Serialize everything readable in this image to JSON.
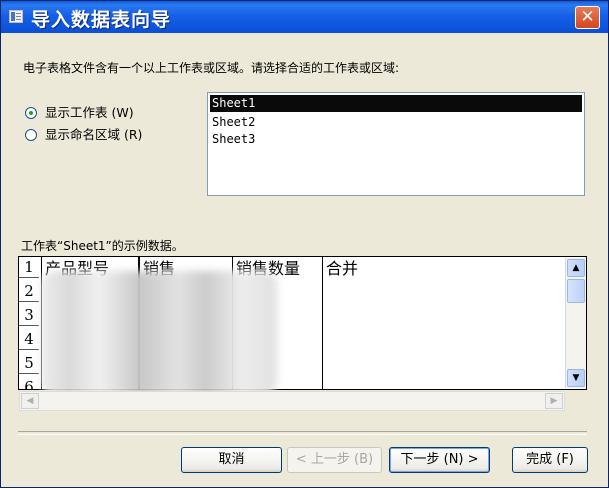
{
  "window": {
    "title": "导入数据表向导",
    "close_label": "✕"
  },
  "instructions": "电子表格文件含有一个以上工作表或区域。请选择合适的工作表或区域:",
  "options": [
    {
      "label": "显示工作表 (W)",
      "checked": true
    },
    {
      "label": "显示命名区域 (R)",
      "checked": false
    }
  ],
  "sheets": [
    {
      "name": "Sheet1",
      "selected": true
    },
    {
      "name": "Sheet2",
      "selected": false
    },
    {
      "name": "Sheet3",
      "selected": false
    }
  ],
  "sample_label": "工作表“Sheet1”的示例数据。",
  "grid": {
    "row_numbers": [
      "1",
      "2",
      "3",
      "4",
      "5",
      "6"
    ],
    "columns": [
      "产品型号",
      "销售",
      "销售数量",
      "合并"
    ]
  },
  "buttons": {
    "cancel": "取消",
    "back": "< 上一步 (B)",
    "next": "下一步 (N) >",
    "finish": "完成 (F)"
  },
  "colors": {
    "titlebar": "#0a5fe0",
    "close": "#d2471f",
    "selection": "#0a0a0a"
  }
}
